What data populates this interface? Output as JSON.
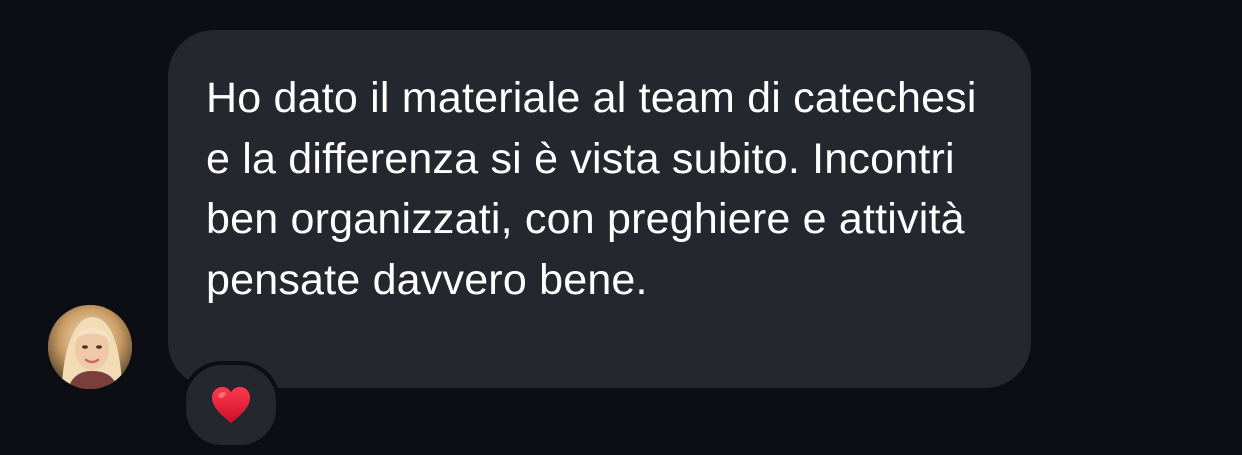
{
  "message": {
    "text": "Ho dato il materiale al team di catechesi e la differenza si è vista subito. Incontri ben organizzati, con preghiere e attività pensate davvero bene."
  },
  "avatar": {
    "icon": "user-photo-icon"
  },
  "reaction": {
    "emoji": "heart-icon",
    "color": "#e0182d"
  },
  "colors": {
    "background": "#0d0e14",
    "bubble": "#25272e",
    "text": "#ffffff"
  }
}
